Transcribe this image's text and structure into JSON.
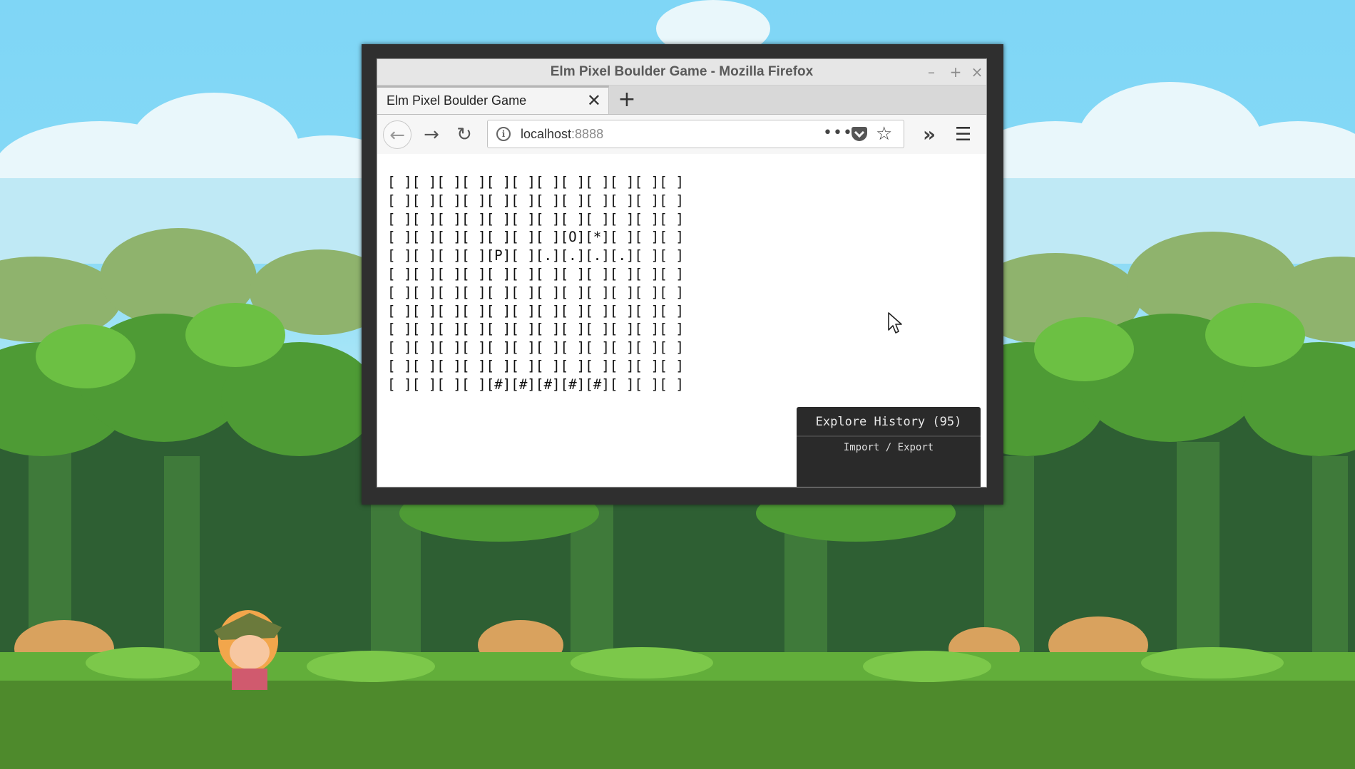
{
  "window": {
    "title": "Elm Pixel Boulder Game - Mozilla Firefox",
    "controls": {
      "minimize": "–",
      "maximize": "+",
      "close": "×"
    }
  },
  "tabs": [
    {
      "label": "Elm Pixel Boulder Game",
      "close": "✕",
      "active": true
    }
  ],
  "new_tab": "+",
  "nav": {
    "back": "←",
    "forward": "→",
    "reload": "↻",
    "url_host": "localhost",
    "url_port": ":8888",
    "page_actions": "•••",
    "bookmark": "☆",
    "overflow": "»",
    "menu": "☰"
  },
  "game": {
    "rows": [
      "[ ][ ][ ][ ][ ][ ][ ][ ][ ][ ][ ][ ]",
      "[ ][ ][ ][ ][ ][ ][ ][ ][ ][ ][ ][ ]",
      "[ ][ ][ ][ ][ ][ ][ ][ ][ ][ ][ ][ ]",
      "[ ][ ][ ][ ][ ][ ][ ][O][*][ ][ ][ ]",
      "[ ][ ][ ][ ][P][ ][.][.][.][.][ ][ ]",
      "[ ][ ][ ][ ][ ][ ][ ][ ][ ][ ][ ][ ]",
      "[ ][ ][ ][ ][ ][ ][ ][ ][ ][ ][ ][ ]",
      "[ ][ ][ ][ ][ ][ ][ ][ ][ ][ ][ ][ ]",
      "[ ][ ][ ][ ][ ][ ][ ][ ][ ][ ][ ][ ]",
      "[ ][ ][ ][ ][ ][ ][ ][ ][ ][ ][ ][ ]",
      "[ ][ ][ ][ ][ ][ ][ ][ ][ ][ ][ ][ ]",
      "[ ][ ][ ][ ][#][#][#][#][#][ ][ ][ ]"
    ]
  },
  "history_panel": {
    "title": "Explore History (95)",
    "subtitle": "Import / Export"
  },
  "colors": {
    "sky": "#7fd6f6",
    "foliage_light": "#58b43a",
    "foliage_dark": "#2f6a2a",
    "ground": "#4e8a2c",
    "panel_bg": "#2a2a2a"
  }
}
